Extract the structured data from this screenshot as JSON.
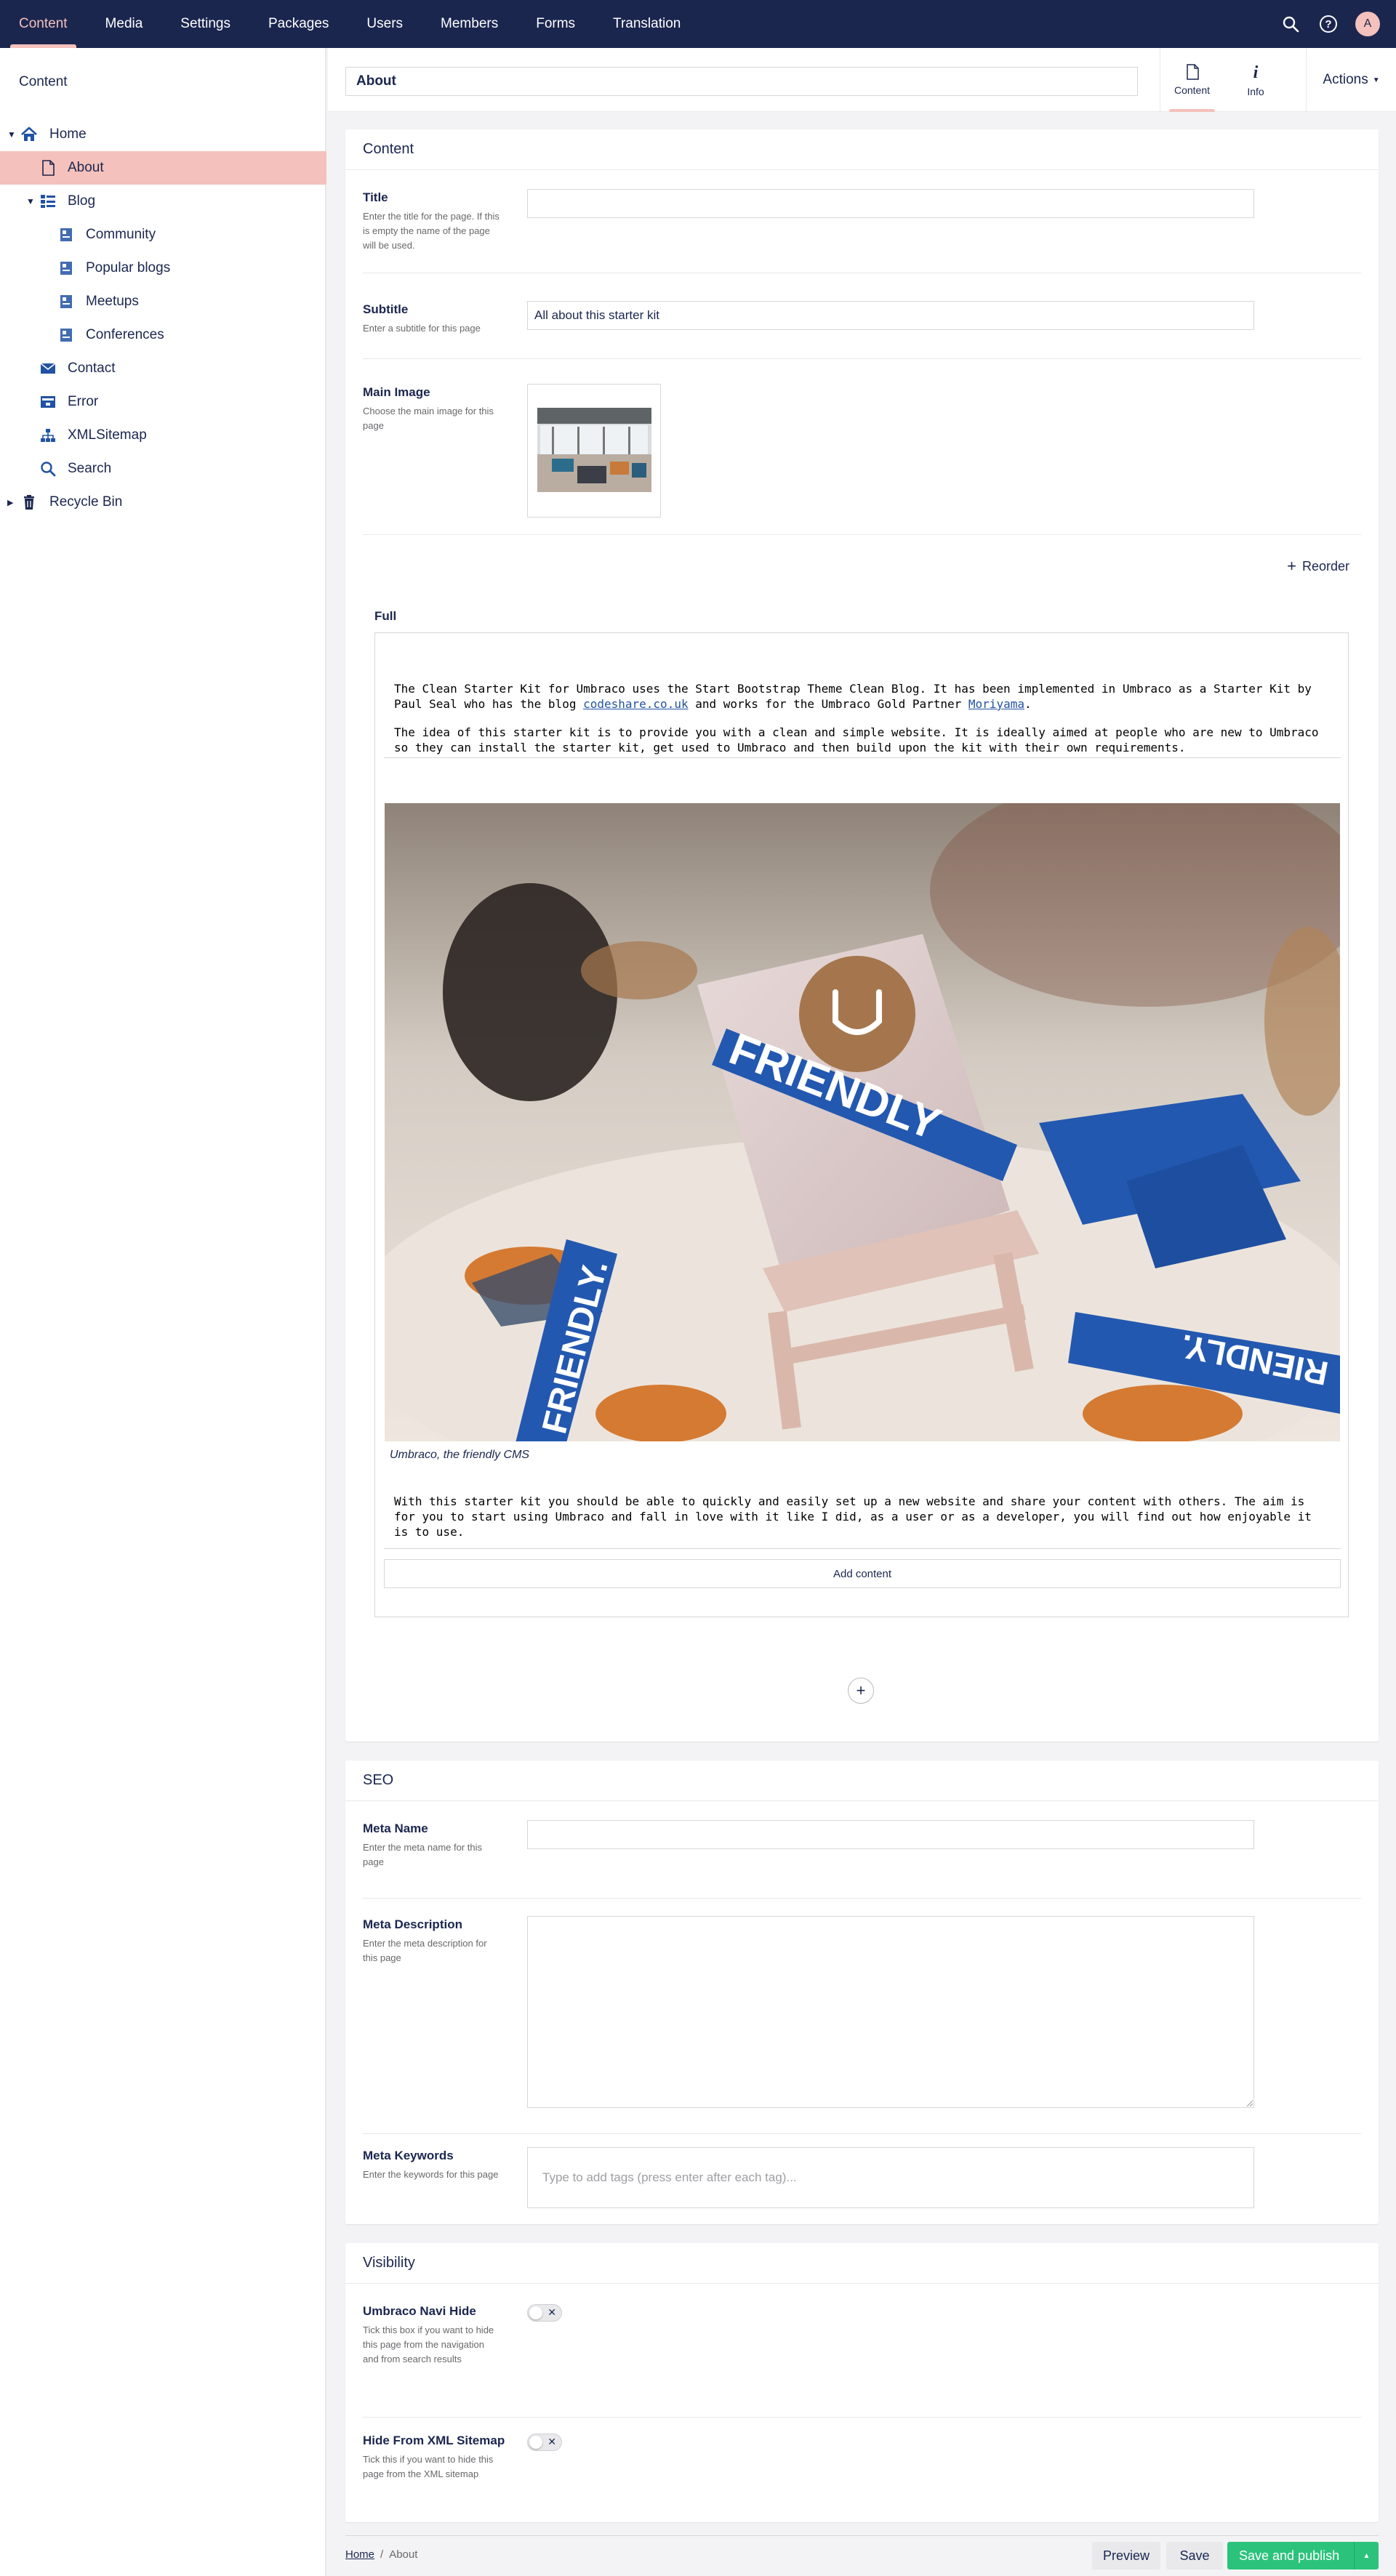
{
  "topnav": {
    "items": [
      "Content",
      "Media",
      "Settings",
      "Packages",
      "Users",
      "Members",
      "Forms",
      "Translation"
    ],
    "active_index": 0,
    "avatar_initial": "A",
    "icons": [
      "search-icon",
      "help-icon",
      "avatar"
    ]
  },
  "sidebar": {
    "title": "Content",
    "tree": [
      {
        "label": "Home",
        "icon": "home-icon",
        "expanded": true
      },
      {
        "label": "About",
        "icon": "document-icon",
        "active": true
      },
      {
        "label": "Blog",
        "icon": "thumbnail-list-icon",
        "expanded": true
      },
      {
        "label": "Community",
        "icon": "article-icon"
      },
      {
        "label": "Popular blogs",
        "icon": "article-icon"
      },
      {
        "label": "Meetups",
        "icon": "article-icon"
      },
      {
        "label": "Conferences",
        "icon": "article-icon"
      },
      {
        "label": "Contact",
        "icon": "mail-icon"
      },
      {
        "label": "Error",
        "icon": "error-page-icon"
      },
      {
        "label": "XMLSitemap",
        "icon": "sitemap-icon"
      },
      {
        "label": "Search",
        "icon": "search-icon"
      },
      {
        "label": "Recycle Bin",
        "icon": "trash-icon",
        "expanded": false
      }
    ]
  },
  "header": {
    "node_name": "About",
    "apps": [
      "Content",
      "Info"
    ],
    "actions_label": "Actions"
  },
  "content_group": {
    "title": "Content",
    "title_prop": {
      "label": "Title",
      "description": "Enter the title for the page. If this is empty the name of the page will be used.",
      "value": ""
    },
    "subtitle_prop": {
      "label": "Subtitle",
      "description": "Enter a subtitle for this page",
      "value": "All about this starter kit"
    },
    "main_image_prop": {
      "label": "Main Image",
      "description": "Choose the main image for this page"
    },
    "reorder_label": "Reorder",
    "grid_section_label": "Full",
    "rte1": {
      "p1_a": "The Clean Starter Kit for Umbraco uses the Start Bootstrap Theme Clean Blog. It has been implemented in Umbraco as a Starter Kit by Paul Seal who has the blog ",
      "p1_link1": "codeshare.co.uk",
      "p1_b": " and works for the Umbraco Gold Partner ",
      "p1_link2": "Moriyama",
      "p1_c": ".",
      "p2": "The idea of this starter kit is to provide you with a clean and simple website. It is ideally aimed at people who are new to Umbraco so they can install the starter kit, get used to Umbraco and then build upon the kit with their own requirements."
    },
    "image_caption": "Umbraco, the friendly CMS",
    "image_text_1": "FRIENDLY",
    "image_text_2": "FRIENDLY.",
    "image_text_3": "RIENDLY.",
    "rte2": "With this starter kit you should be able to quickly and easily set up a new website and share your content with others. The aim is for you to start using Umbraco and fall in love with it like I did, as a user or as a developer, you will find out how enjoyable it is to use.",
    "add_content_label": "Add content"
  },
  "seo_group": {
    "title": "SEO",
    "meta_name": {
      "label": "Meta Name",
      "description": "Enter the meta name for this page",
      "value": ""
    },
    "meta_description": {
      "label": "Meta Description",
      "description": "Enter the meta description for this page",
      "value": ""
    },
    "meta_keywords": {
      "label": "Meta Keywords",
      "description": "Enter the keywords for this page",
      "placeholder": "Type to add tags (press enter after each tag)..."
    }
  },
  "visibility_group": {
    "title": "Visibility",
    "navi_hide": {
      "label": "Umbraco Navi Hide",
      "description": "Tick this box if you want to hide this page from the navigation and from search results",
      "checked": false
    },
    "sitemap_hide": {
      "label": "Hide From XML Sitemap",
      "description": "Tick this if you want to hide this page from the XML sitemap",
      "checked": false
    }
  },
  "footer": {
    "breadcrumb": [
      "Home",
      "About"
    ],
    "preview_label": "Preview",
    "save_label": "Save",
    "publish_label": "Save and publish"
  },
  "colors": {
    "topbar": "#1b264f",
    "active_pink": "#f5c1bc",
    "publish_green": "#2bc37c",
    "icon_blue": "#2152a3"
  }
}
